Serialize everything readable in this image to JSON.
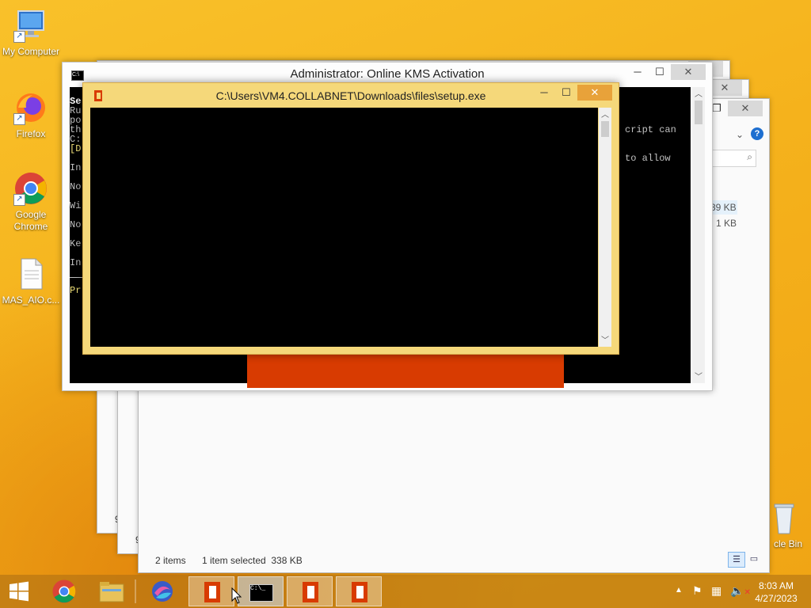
{
  "desktop": {
    "icons": [
      {
        "label": "My Computer",
        "icon": "computer-icon"
      },
      {
        "label": "Firefox",
        "icon": "firefox-icon"
      },
      {
        "label": "Google Chrome",
        "icon": "chrome-icon"
      },
      {
        "label": "MAS_AIO.c...",
        "icon": "file-icon"
      },
      {
        "label": "cle Bin",
        "icon": "recycle-bin-icon"
      }
    ]
  },
  "explorer": {
    "status_items": "2 items",
    "status_selected": "1 item selected  338 KB",
    "file_sizes": [
      "39 KB",
      "1 KB"
    ],
    "partial_labels": [
      "9",
      "9"
    ],
    "help_icon": "?"
  },
  "admin_window": {
    "title": "Administrator:  Online KMS Activation",
    "lines_left": [
      "Se",
      "Ru",
      "po",
      "th",
      "C:",
      "[D",
      "In",
      "No",
      "Wi",
      "No",
      "Ke",
      "In",
      "Pr"
    ],
    "lines_right": [
      "cript can",
      "to allow"
    ]
  },
  "setup_window": {
    "title": "C:\\Users\\VM4.COLLABNET\\Downloads\\files\\setup.exe"
  },
  "taskbar": {
    "time": "8:03 AM",
    "date": "4/27/2023",
    "buttons": [
      "start-button",
      "chrome",
      "file-explorer",
      "app",
      "office",
      "cmd",
      "office",
      "office"
    ]
  },
  "colors": {
    "office_red": "#d83b01",
    "setup_frame": "#f5d87a",
    "console_bg": "#000000"
  }
}
